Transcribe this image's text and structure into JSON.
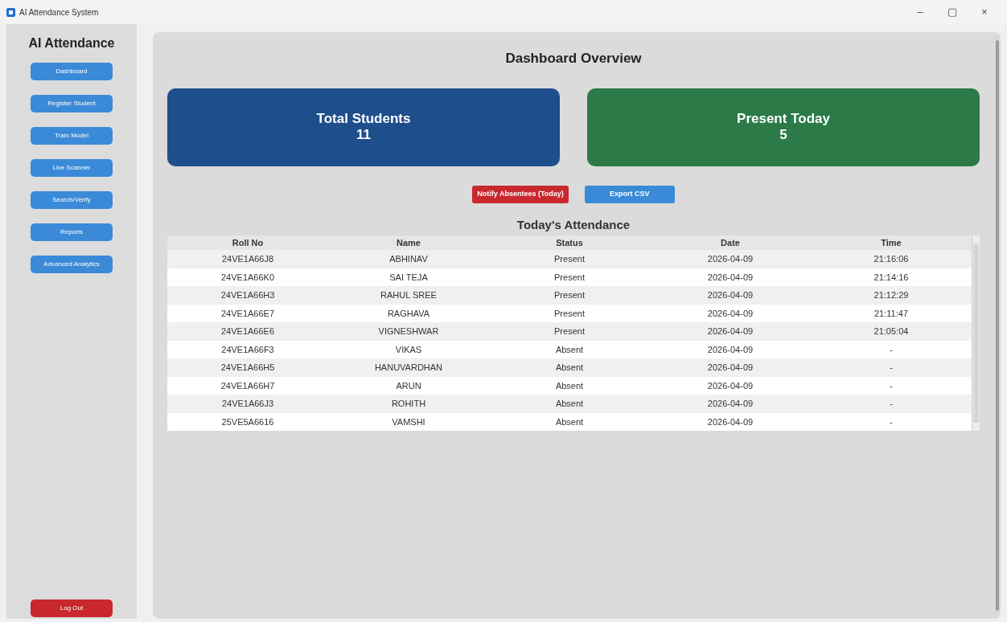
{
  "window": {
    "title": "AI Attendance System",
    "controls": [
      "–",
      "▢",
      "×"
    ]
  },
  "sidebar": {
    "title": "AI Attendance",
    "items": [
      {
        "label": "Dashboard"
      },
      {
        "label": "Register Student"
      },
      {
        "label": "Train Model"
      },
      {
        "label": "Live Scanner"
      },
      {
        "label": "Search/Verify"
      },
      {
        "label": "Reports"
      },
      {
        "label": "Advanced Analytics"
      }
    ],
    "logout": "Log Out"
  },
  "main": {
    "title": "Dashboard Overview",
    "stats": [
      {
        "label": "Total Students",
        "value": "11",
        "color": "#1f4e8c"
      },
      {
        "label": "Present Today",
        "value": "5",
        "color": "#2b7a48"
      }
    ],
    "actions": [
      {
        "label": "Notify Absentees (Today)",
        "kind": "danger"
      },
      {
        "label": "Export CSV",
        "kind": "primary"
      }
    ],
    "table": {
      "title": "Today's Attendance",
      "columns": [
        "Roll No",
        "Name",
        "Status",
        "Date",
        "Time"
      ],
      "rows": [
        [
          "24VE1A66J8",
          "ABHINAV",
          "Present",
          "2026-04-09",
          "21:16:06"
        ],
        [
          "24VE1A66K0",
          "SAI TEJA",
          "Present",
          "2026-04-09",
          "21:14:16"
        ],
        [
          "24VE1A66H3",
          "RAHUL SREE",
          "Present",
          "2026-04-09",
          "21:12:29"
        ],
        [
          "24VE1A66E7",
          "RAGHAVA",
          "Present",
          "2026-04-09",
          "21:11:47"
        ],
        [
          "24VE1A66E6",
          "VIGNESHWAR",
          "Present",
          "2026-04-09",
          "21:05:04"
        ],
        [
          "24VE1A66F3",
          "VIKAS",
          "Absent",
          "2026-04-09",
          "-"
        ],
        [
          "24VE1A66H5",
          "HANUVARDHAN",
          "Absent",
          "2026-04-09",
          "-"
        ],
        [
          "24VE1A66H7",
          "ARUN",
          "Absent",
          "2026-04-09",
          "-"
        ],
        [
          "24VE1A66J3",
          "ROHITH",
          "Absent",
          "2026-04-09",
          "-"
        ],
        [
          "25VE5A6616",
          "VAMSHI",
          "Absent",
          "2026-04-09",
          "-"
        ]
      ]
    }
  }
}
